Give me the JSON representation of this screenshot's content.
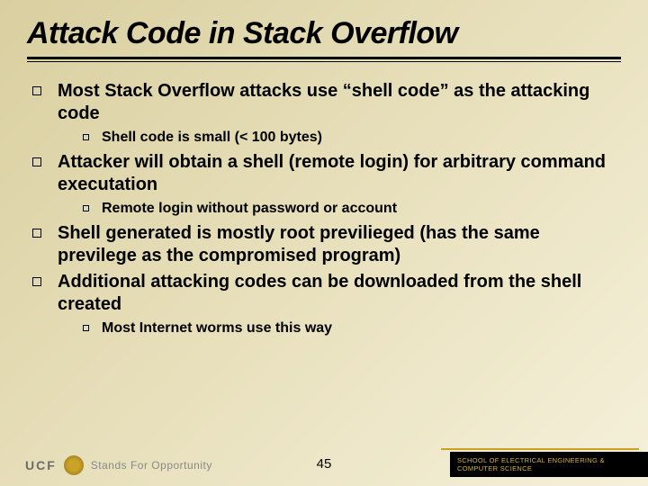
{
  "title": "Attack Code in Stack Overflow",
  "bullets": [
    {
      "level": 1,
      "text": "Most Stack Overflow attacks use “shell code” as the attacking code"
    },
    {
      "level": 2,
      "text": "Shell code is small (< 100 bytes)"
    },
    {
      "level": 1,
      "text": "Attacker will obtain a shell (remote login) for arbitrary command executation"
    },
    {
      "level": 2,
      "text": "Remote login without password or account"
    },
    {
      "level": 1,
      "text": "Shell generated is mostly root previlieged (has the same previlege as the compromised program)"
    },
    {
      "level": 1,
      "text": "Additional attacking codes can be downloaded from the shell created"
    },
    {
      "level": 2,
      "text": "Most Internet worms use this way"
    }
  ],
  "footer": {
    "ucf": "UCF",
    "tagline": "Stands For Opportunity",
    "page": "45",
    "school": "SCHOOL OF ELECTRICAL ENGINEERING & COMPUTER SCIENCE"
  }
}
